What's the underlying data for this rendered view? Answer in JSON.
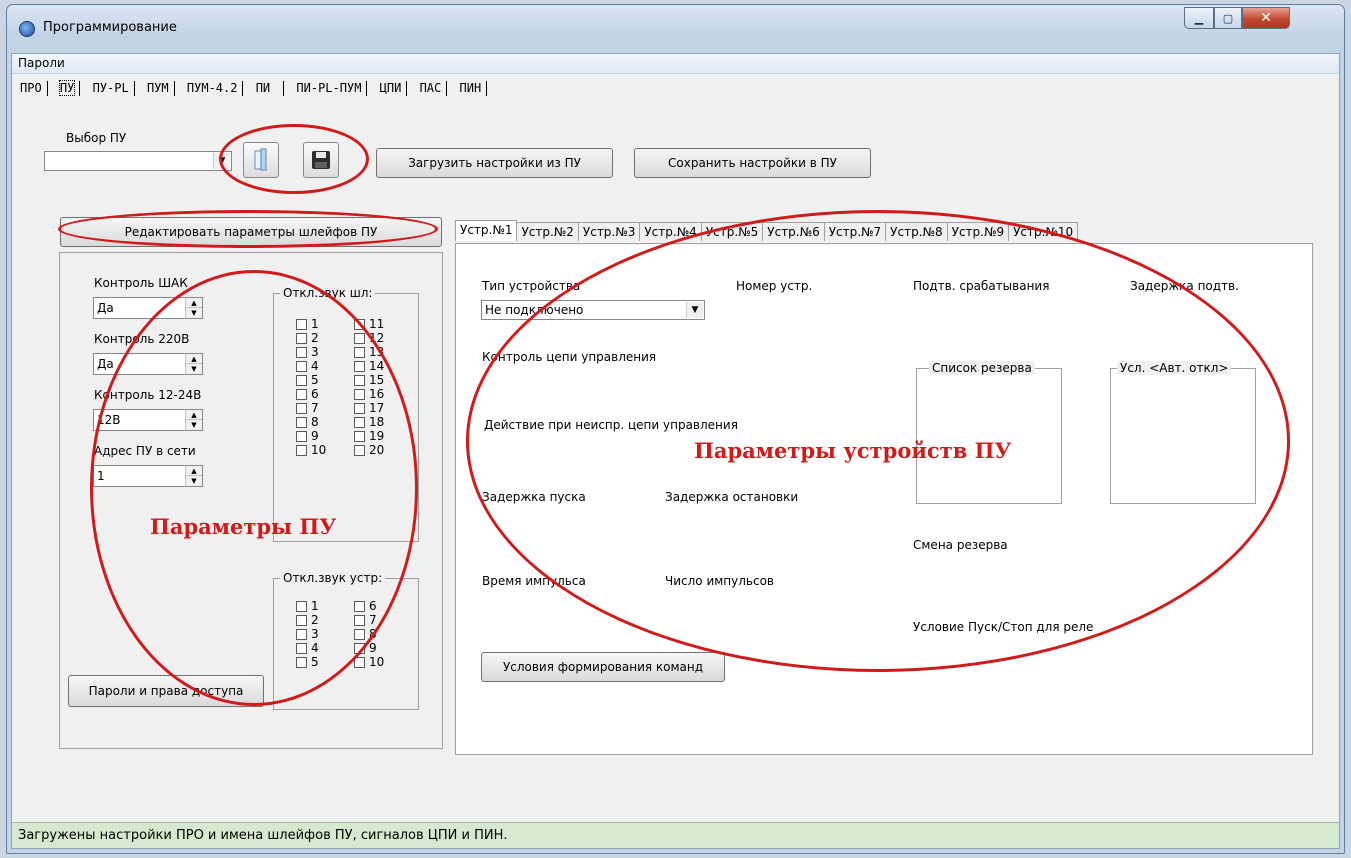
{
  "window": {
    "title": "Программирование",
    "caption_min": "▁",
    "caption_max": "▢",
    "caption_close": "✕"
  },
  "menu": {
    "items": [
      "Пароли"
    ]
  },
  "top_tabs": [
    "ПРО",
    "ПУ",
    "ПУ-PL",
    "ПУМ",
    "ПУМ-4.2",
    "ПИ",
    "ПИ-PL-ПУМ",
    "ЦПИ",
    "ПАС",
    "ПИН"
  ],
  "top_tab_selected": "ПУ",
  "pu_select": {
    "label": "Выбор ПУ",
    "value": ""
  },
  "toolbar": {
    "open_icon": "folder-icon",
    "save_icon": "floppy-disk-icon",
    "load_label": "Загрузить настройки из ПУ",
    "save_label": "Сохранить настройки в ПУ"
  },
  "left_panel": {
    "edit_button": "Редактировать параметры шлейфов ПУ",
    "fields": [
      {
        "label": "Контроль ШАК",
        "value": "Да"
      },
      {
        "label": "Контроль 220В",
        "value": "Да"
      },
      {
        "label": "Контроль 12-24В",
        "value": "12В"
      },
      {
        "label": "Адрес ПУ в сети",
        "value": "1"
      }
    ],
    "loops_group": {
      "title": "Откл.звук шл:",
      "items": [
        "1",
        "2",
        "3",
        "4",
        "5",
        "6",
        "7",
        "8",
        "9",
        "10",
        "11",
        "12",
        "13",
        "14",
        "15",
        "16",
        "17",
        "18",
        "19",
        "20"
      ]
    },
    "devices_group": {
      "title": "Откл.звук устр:",
      "items": [
        "1",
        "2",
        "3",
        "4",
        "5",
        "6",
        "7",
        "8",
        "9",
        "10"
      ]
    },
    "passwords_button": "Пароли и права доступа",
    "annotation": "Параметры ПУ"
  },
  "device_tabs": [
    "Устр.№1",
    "Устр.№2",
    "Устр.№3",
    "Устр.№4",
    "Устр.№5",
    "Устр.№6",
    "Устр.№7",
    "Устр.№8",
    "Устр.№9",
    "Устр.№10"
  ],
  "device_tab_selected": "Устр.№1",
  "device_panel": {
    "type_label": "Тип устройства",
    "type_value": "Не подключено",
    "number_label": "Номер устр.",
    "confirm_label": "Подтв. срабатывания",
    "confirm_delay_label": "Задержка подтв.",
    "control_circuit_label": "Контроль цепи управления",
    "fault_action_label": "Действие при неиспр. цепи управления",
    "start_delay_label": "Задержка пуска",
    "stop_delay_label": "Задержка остановки",
    "pulse_time_label": "Время импульса",
    "pulse_count_label": "Число импульсов",
    "reserve_list_title": "Список резерва",
    "auto_off_title": "Усл. <Авт. откл>",
    "reserve_change_label": "Смена резерва",
    "relay_condition_label": "Условие Пуск/Стоп для реле",
    "commands_button": "Условия формирования команд",
    "annotation": "Параметры устройств ПУ"
  },
  "status": "Загружены настройки ПРО и имена шлейфов ПУ, сигналов ЦПИ и ПИН."
}
